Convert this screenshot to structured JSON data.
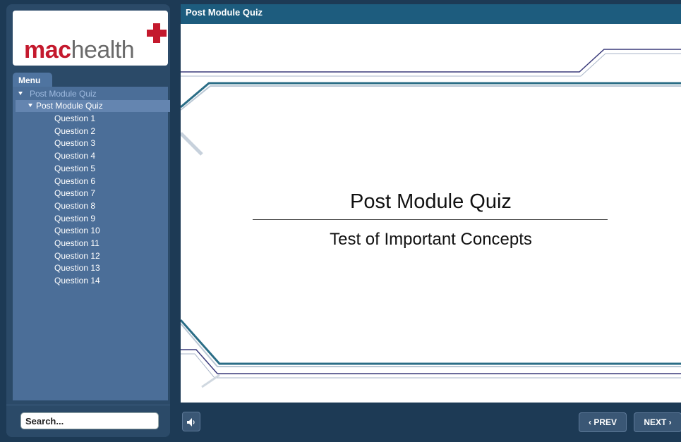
{
  "logo": {
    "part1": "mac",
    "part2": "health"
  },
  "menu": {
    "tab_label": "Menu",
    "root": "Post Module Quiz",
    "section": "Post Module Quiz",
    "items": [
      "Question 1",
      "Question 2",
      "Question 3",
      "Question 4",
      "Question 5",
      "Question 6",
      "Question 7",
      "Question 8",
      "Question 9",
      "Question 10",
      "Question 11",
      "Question 12",
      "Question 13",
      "Question 14"
    ]
  },
  "search": {
    "placeholder": "Search..."
  },
  "header": {
    "title": "Post Module Quiz"
  },
  "slide": {
    "title": "Post Module Quiz",
    "subtitle": "Test of Important Concepts"
  },
  "nav": {
    "prev_label": "‹ PREV",
    "next_label": "NEXT ›"
  },
  "colors": {
    "brand_red": "#c4192d",
    "title_bar": "#1d5c7e",
    "menu_panel": "#4b6e98"
  },
  "icons": {
    "audio": "speaker-icon",
    "logo_cross": "plus-icon"
  }
}
